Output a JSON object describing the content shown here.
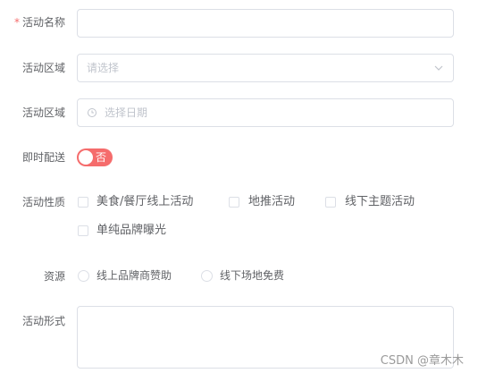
{
  "form": {
    "name": {
      "label": "活动名称",
      "required_mark": "*",
      "value": ""
    },
    "region": {
      "label": "活动区域",
      "placeholder": "请选择"
    },
    "date": {
      "label": "活动区域",
      "placeholder": "选择日期"
    },
    "delivery": {
      "label": "即时配送",
      "toggle_text": "否",
      "on": false
    },
    "nature": {
      "label": "活动性质",
      "options": [
        {
          "label": "美食/餐厅线上活动",
          "checked": false
        },
        {
          "label": "地推活动",
          "checked": false
        },
        {
          "label": "线下主题活动",
          "checked": false
        },
        {
          "label": "单纯品牌曝光",
          "checked": false
        }
      ]
    },
    "resource": {
      "label": "资源",
      "options": [
        {
          "label": "线上品牌商赞助",
          "selected": false
        },
        {
          "label": "线下场地免费",
          "selected": false
        }
      ]
    },
    "form_desc": {
      "label": "活动形式",
      "value": ""
    }
  },
  "watermark": "CSDN @章木木",
  "colors": {
    "danger": "#f56c6c",
    "border": "#dcdfe6",
    "placeholder": "#c0c4cc",
    "text": "#606266"
  },
  "icons": {
    "select_arrow": "chevron-down-icon",
    "date_prefix": "clock-icon"
  }
}
